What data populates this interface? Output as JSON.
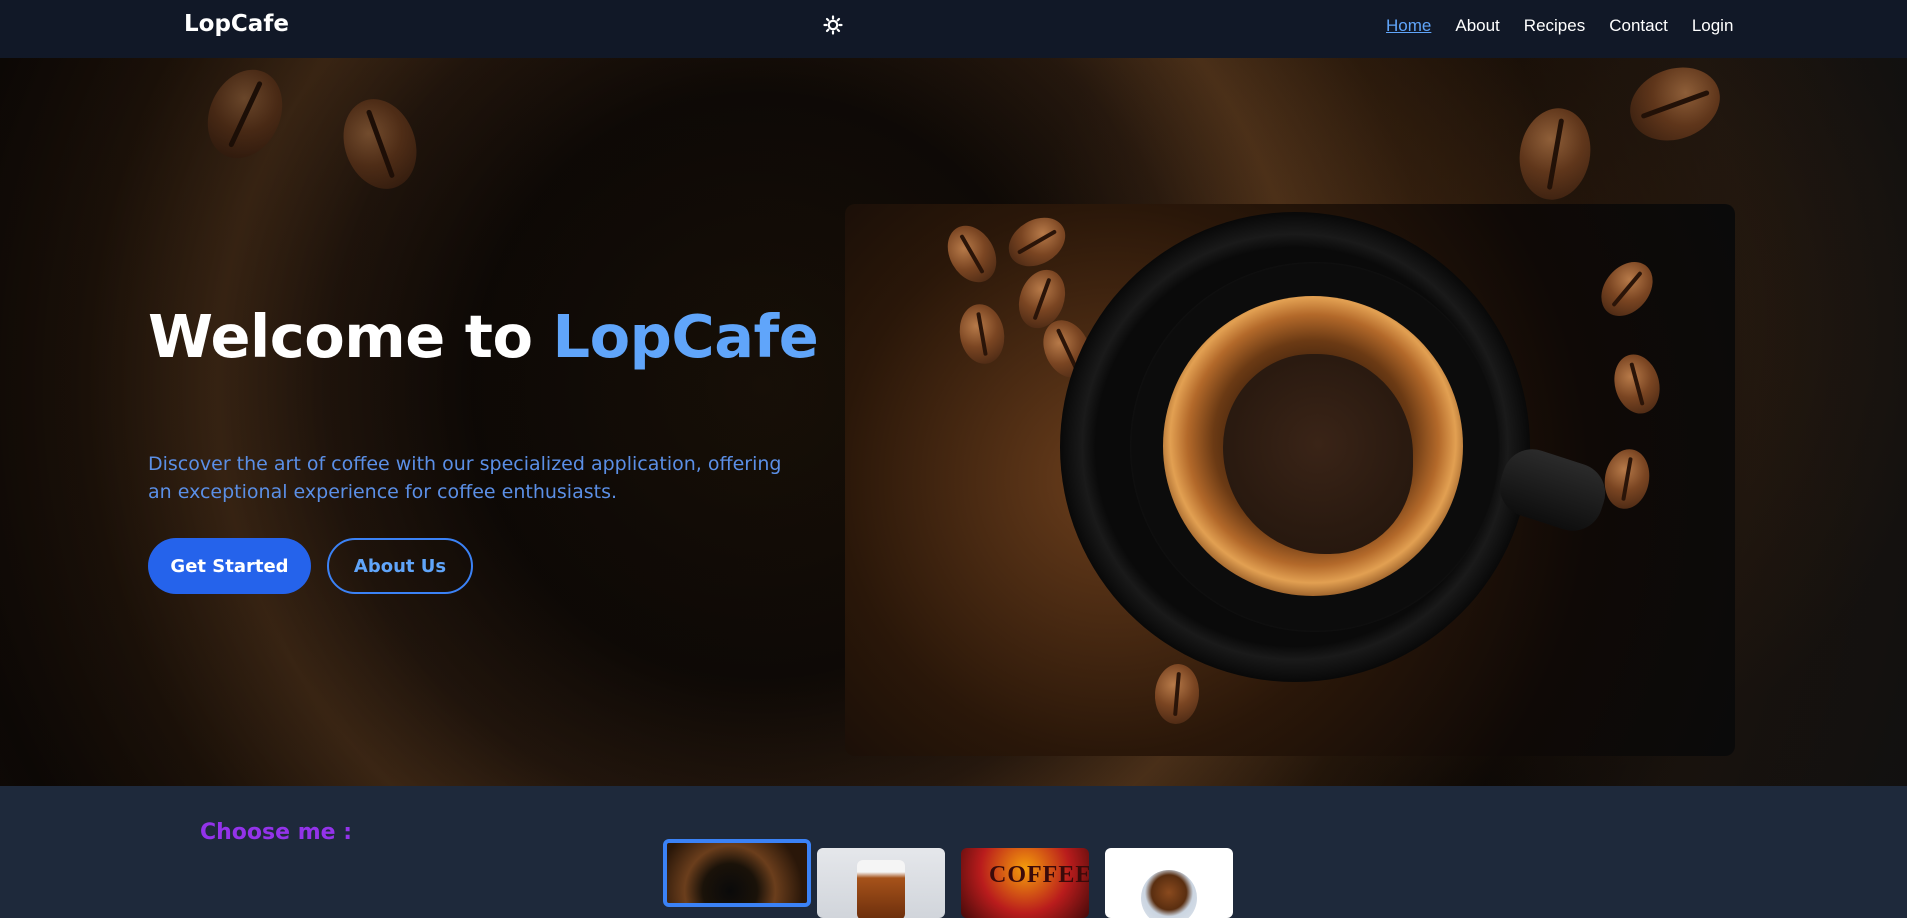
{
  "navbar": {
    "brand": "LopCafe",
    "theme_icon": "sun-icon",
    "links": [
      {
        "label": "Home",
        "active": true
      },
      {
        "label": "About",
        "active": false
      },
      {
        "label": "Recipes",
        "active": false
      },
      {
        "label": "Contact",
        "active": false
      },
      {
        "label": "Login",
        "active": false
      }
    ]
  },
  "hero": {
    "title_prefix": "Welcome to ",
    "title_accent": "LopCafe",
    "description": "Discover the art of coffee with our specialized application, offering an exceptional experience for coffee enthusiasts.",
    "primary_button": "Get Started",
    "secondary_button": "About Us"
  },
  "choose": {
    "title": "Choose me :",
    "thumb3_text": "COFFEE"
  },
  "colors": {
    "navbar_bg": "#111827",
    "accent_blue": "#60a5fa",
    "primary_button": "#2563eb",
    "choose_title": "#9333ea",
    "section_bg": "#1e293b"
  }
}
